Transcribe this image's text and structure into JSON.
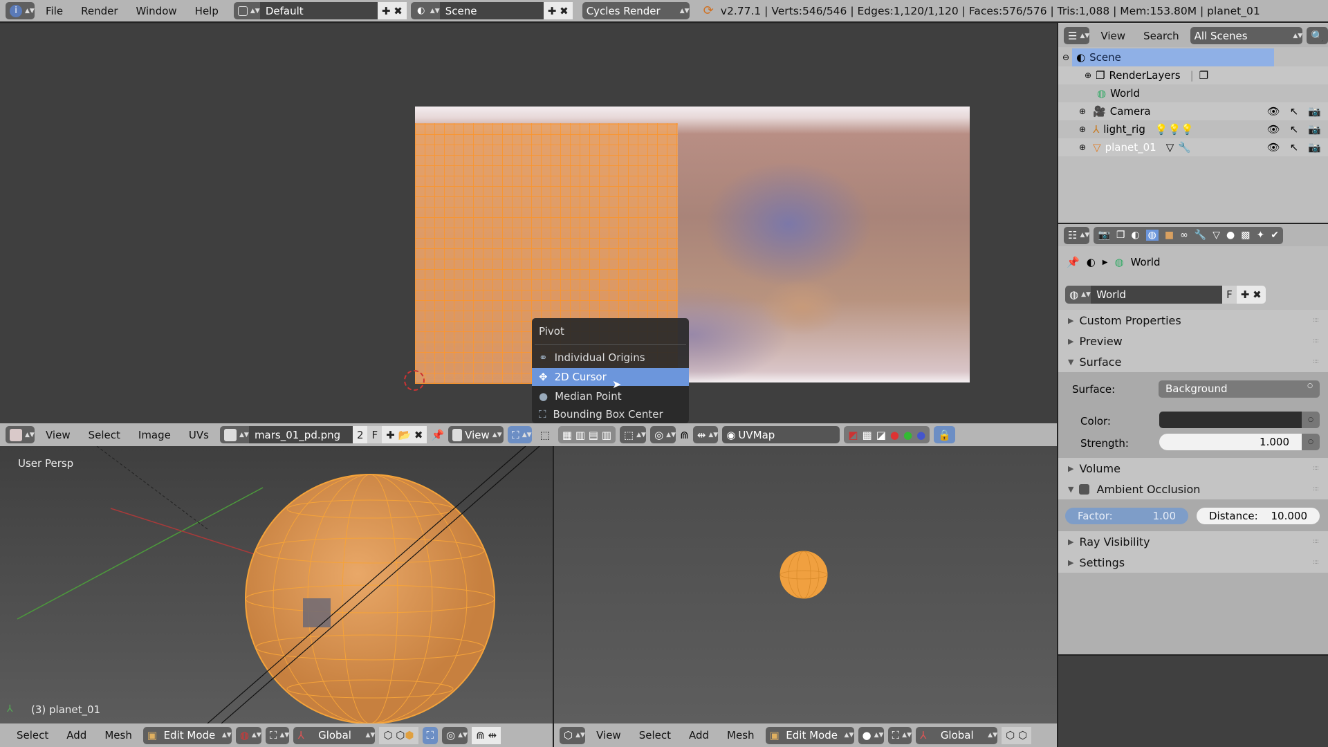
{
  "topbar": {
    "menus": [
      "File",
      "Render",
      "Window",
      "Help"
    ],
    "layout": "Default",
    "scene": "Scene",
    "engine": "Cycles Render",
    "stats": "v2.77.1 | Verts:546/546 | Edges:1,120/1,120 | Faces:576/576 | Tris:1,088 | Mem:153.80M | planet_01"
  },
  "image_editor": {
    "menus": [
      "View",
      "Select",
      "Image",
      "UVs"
    ],
    "image_name": "mars_01_pd.png",
    "users": "2",
    "fake_user": "F",
    "view_mode": "View",
    "uv_map": "UVMap"
  },
  "pivot_menu": {
    "title": "Pivot",
    "items": [
      "Individual Origins",
      "2D Cursor",
      "Median Point",
      "Bounding Box Center"
    ],
    "selected": "2D Cursor"
  },
  "viewport_left": {
    "label": "User Persp",
    "object_label": "(3) planet_01",
    "menus": [
      "Select",
      "Add",
      "Mesh"
    ],
    "mode": "Edit Mode",
    "orientation": "Global"
  },
  "viewport_right": {
    "menus": [
      "View",
      "Select",
      "Add",
      "Mesh"
    ],
    "mode": "Edit Mode",
    "orientation": "Global"
  },
  "outliner": {
    "menus": [
      "View",
      "Search"
    ],
    "filter": "All Scenes",
    "items": [
      {
        "label": "Scene",
        "icon": "scene-icon",
        "selected": true
      },
      {
        "label": "RenderLayers",
        "icon": "render-layers-icon"
      },
      {
        "label": "World",
        "icon": "world-icon"
      },
      {
        "label": "Camera",
        "icon": "camera-icon"
      },
      {
        "label": "light_rig",
        "icon": "empty-icon"
      },
      {
        "label": "planet_01",
        "icon": "mesh-icon",
        "active": true
      }
    ]
  },
  "properties": {
    "breadcrumb": "World",
    "world_name": "World",
    "fake_user": "F",
    "panels": {
      "custom_properties": "Custom Properties",
      "preview": "Preview",
      "surface": "Surface",
      "volume": "Volume",
      "ao": "Ambient Occlusion",
      "ray_visibility": "Ray Visibility",
      "settings": "Settings"
    },
    "surface_label": "Surface:",
    "surface_value": "Background",
    "color_label": "Color:",
    "color_value": "#2e2e2e",
    "strength_label": "Strength:",
    "strength_value": "1.000",
    "factor_label": "Factor:",
    "factor_value": "1.00",
    "distance_label": "Distance:",
    "distance_value": "10.000"
  },
  "colors": {
    "accent": "#7ea0d6",
    "selection_orange": "#f5a33a",
    "header": "#b5b5b5"
  }
}
